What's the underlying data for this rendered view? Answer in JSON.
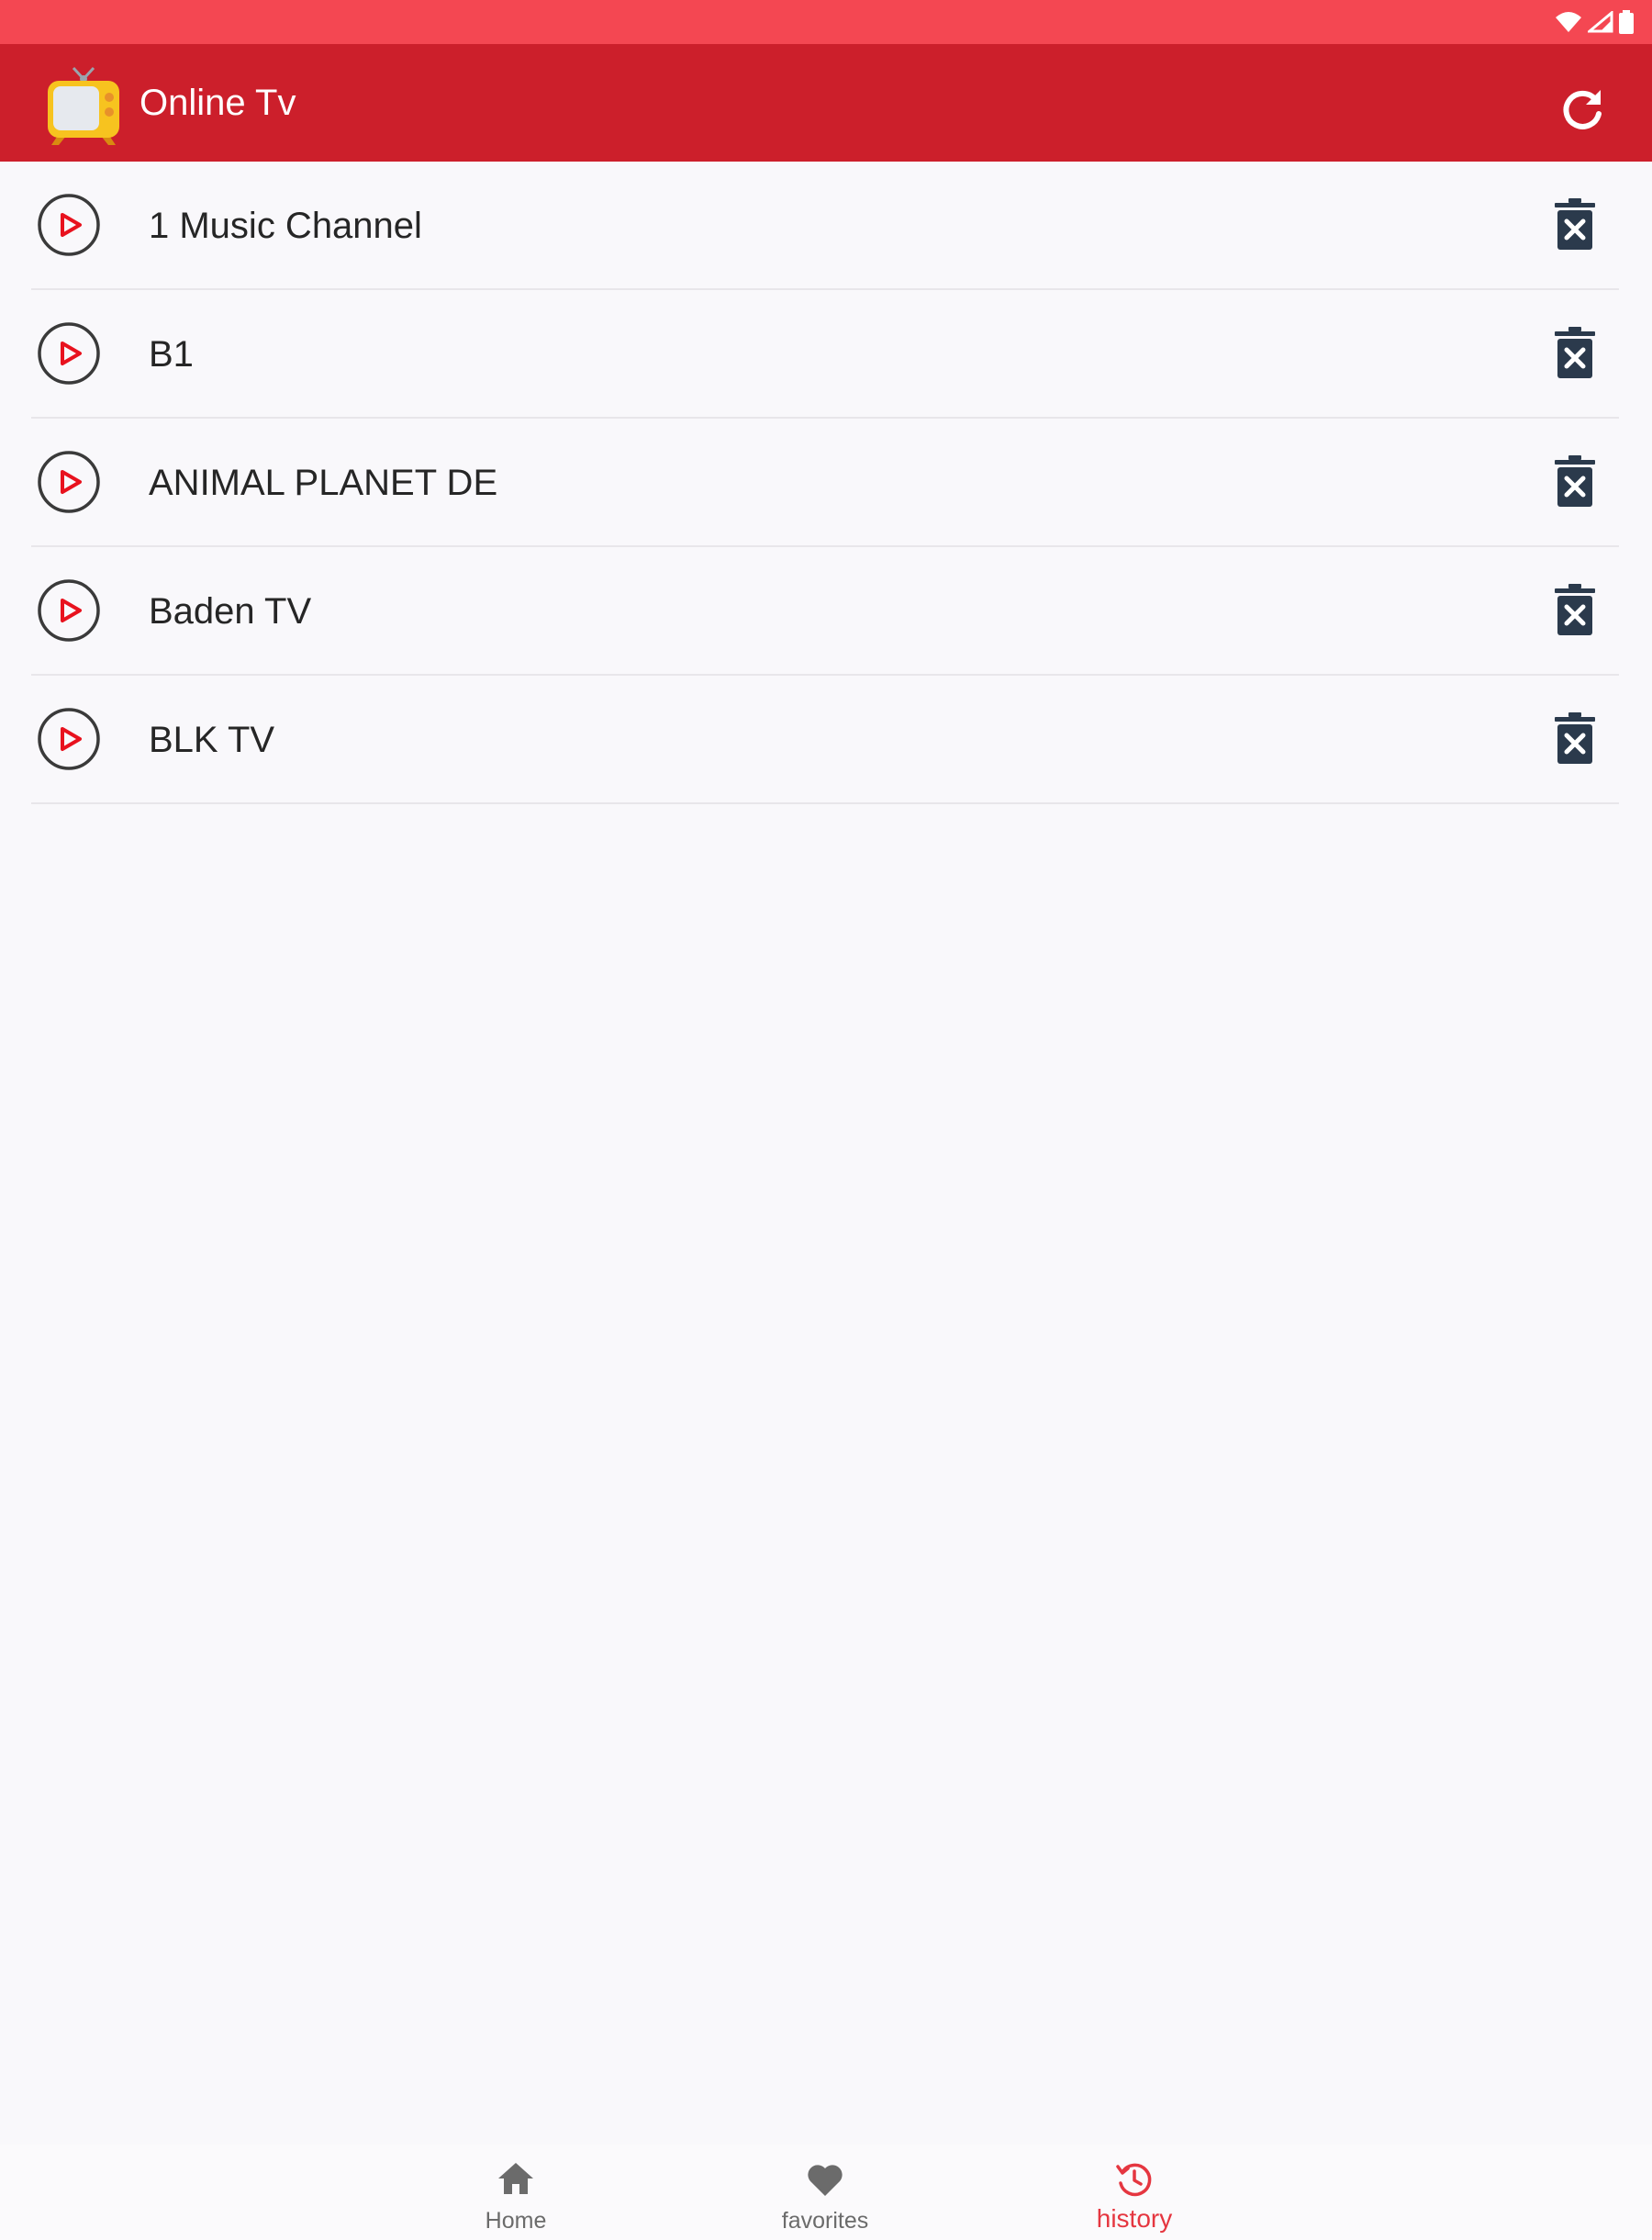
{
  "colors": {
    "statusbar": "#f44752",
    "appbar": "#cc1f2b",
    "accent": "#e53640",
    "play_icon": "#e8121e",
    "delete_icon": "#2b3a4c",
    "nav_inactive": "#6b6b6b"
  },
  "app": {
    "title": "Online Tv",
    "logo_icon": "tv-icon",
    "refresh_icon": "refresh-icon"
  },
  "history": {
    "items": [
      {
        "label": "1 Music Channel",
        "play_icon": "play-circle-icon",
        "delete_icon": "trash-x-icon"
      },
      {
        "label": "B1",
        "play_icon": "play-circle-icon",
        "delete_icon": "trash-x-icon"
      },
      {
        "label": "ANIMAL PLANET DE",
        "play_icon": "play-circle-icon",
        "delete_icon": "trash-x-icon"
      },
      {
        "label": "Baden TV",
        "play_icon": "play-circle-icon",
        "delete_icon": "trash-x-icon"
      },
      {
        "label": "BLK TV",
        "play_icon": "play-circle-icon",
        "delete_icon": "trash-x-icon"
      }
    ]
  },
  "bottom_nav": {
    "items": [
      {
        "label": "Home",
        "icon": "home-icon",
        "active": false
      },
      {
        "label": "favorites",
        "icon": "heart-icon",
        "active": false
      },
      {
        "label": "history",
        "icon": "history-icon",
        "active": true
      }
    ]
  }
}
